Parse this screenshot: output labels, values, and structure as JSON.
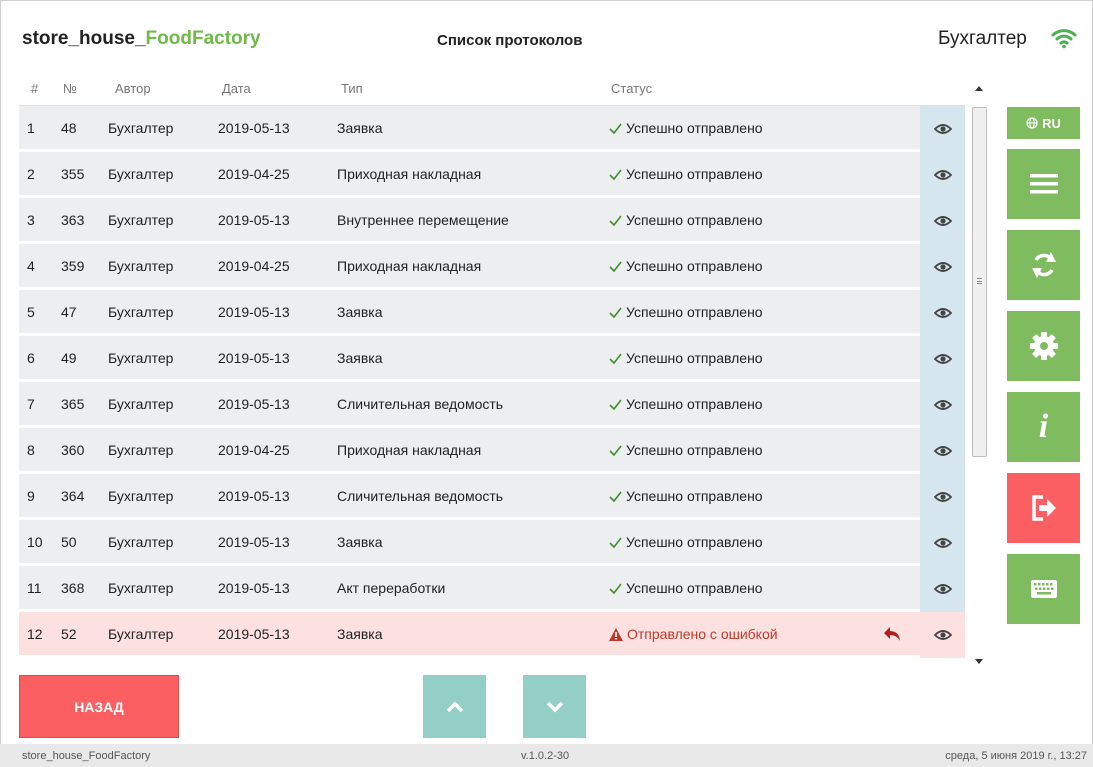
{
  "header": {
    "app_name_prefix": "store_house_",
    "app_name_suffix": "FoodFactory",
    "page_title": "Список протоколов",
    "user": "Бухгалтер"
  },
  "table": {
    "columns": [
      "#",
      "№",
      "Автор",
      "Дата",
      "Тип",
      "Статус"
    ],
    "rows": [
      {
        "num": "1",
        "no": "48",
        "author": "Бухгалтер",
        "date": "2019-05-13",
        "type": "Заявка",
        "status": "Успешно отправлено",
        "error": false
      },
      {
        "num": "2",
        "no": "355",
        "author": "Бухгалтер",
        "date": "2019-04-25",
        "type": "Приходная накладная",
        "status": "Успешно отправлено",
        "error": false
      },
      {
        "num": "3",
        "no": "363",
        "author": "Бухгалтер",
        "date": "2019-05-13",
        "type": "Внутреннее перемещение",
        "status": "Успешно отправлено",
        "error": false
      },
      {
        "num": "4",
        "no": "359",
        "author": "Бухгалтер",
        "date": "2019-04-25",
        "type": "Приходная накладная",
        "status": "Успешно отправлено",
        "error": false
      },
      {
        "num": "5",
        "no": "47",
        "author": "Бухгалтер",
        "date": "2019-05-13",
        "type": "Заявка",
        "status": "Успешно отправлено",
        "error": false
      },
      {
        "num": "6",
        "no": "49",
        "author": "Бухгалтер",
        "date": "2019-05-13",
        "type": "Заявка",
        "status": "Успешно отправлено",
        "error": false
      },
      {
        "num": "7",
        "no": "365",
        "author": "Бухгалтер",
        "date": "2019-05-13",
        "type": "Сличительная ведомость",
        "status": "Успешно отправлено",
        "error": false
      },
      {
        "num": "8",
        "no": "360",
        "author": "Бухгалтер",
        "date": "2019-04-25",
        "type": "Приходная накладная",
        "status": "Успешно отправлено",
        "error": false
      },
      {
        "num": "9",
        "no": "364",
        "author": "Бухгалтер",
        "date": "2019-05-13",
        "type": "Сличительная ведомость",
        "status": "Успешно отправлено",
        "error": false
      },
      {
        "num": "10",
        "no": "50",
        "author": "Бухгалтер",
        "date": "2019-05-13",
        "type": "Заявка",
        "status": "Успешно отправлено",
        "error": false
      },
      {
        "num": "11",
        "no": "368",
        "author": "Бухгалтер",
        "date": "2019-05-13",
        "type": "Акт переработки",
        "status": "Успешно отправлено",
        "error": false
      },
      {
        "num": "12",
        "no": "52",
        "author": "Бухгалтер",
        "date": "2019-05-13",
        "type": "Заявка",
        "status": "Отправлено с ошибкой",
        "error": true
      }
    ]
  },
  "sidebar": {
    "lang": "RU",
    "icons": [
      "globe-icon",
      "menu-icon",
      "sync-icon",
      "gear-icon",
      "info-icon",
      "logout-icon",
      "keyboard-icon"
    ]
  },
  "bottom": {
    "back_label": "НАЗАД"
  },
  "footer": {
    "app": "store_house_FoodFactory",
    "version": "v.1.0.2-30",
    "datetime": "среда, 5 июня 2019 г., 13:27"
  },
  "colors": {
    "accent_green": "#7fbb5f",
    "danger_red": "#fb5f62",
    "teal": "#93cfc7",
    "success_text": "#3e8e2f",
    "error_text": "#c0392b"
  }
}
